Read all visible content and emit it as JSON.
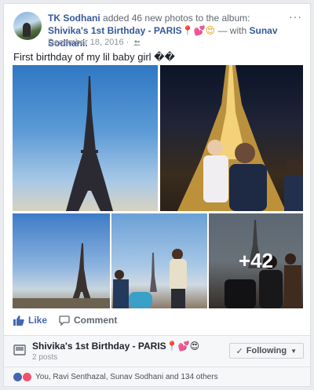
{
  "post": {
    "author": "TK Sodhani",
    "action": "added 46 new photos to the album:",
    "album_link": "Shivika's 1st Birthday - PARIS",
    "emoji_pin": "📍",
    "emoji_hearts": "💕",
    "emoji_smile": "😍",
    "with_text": "— with",
    "tagged": "Sunav Sodhani.",
    "date": "December 18, 2016 ·",
    "privacy_icon": "friends-icon",
    "more_label": "···",
    "caption": "First birthday of my lil baby girl ��"
  },
  "photos": {
    "overlay_count": "+42"
  },
  "actions": {
    "like_label": "Like",
    "comment_label": "Comment"
  },
  "album_bar": {
    "title": "Shivika's 1st Birthday - PARIS",
    "emoji": "📍💕😍",
    "subtitle": "2 posts",
    "following_label": "Following",
    "following_check": "✓",
    "following_caret": "▼"
  },
  "reactions": {
    "summary": "You, Ravi Senthazal, Sunav Sodhani and 134 others"
  },
  "colors": {
    "link": "#365899",
    "like_blue": "#4267b2",
    "love_red": "#f25268",
    "background": "#e9ebee"
  }
}
